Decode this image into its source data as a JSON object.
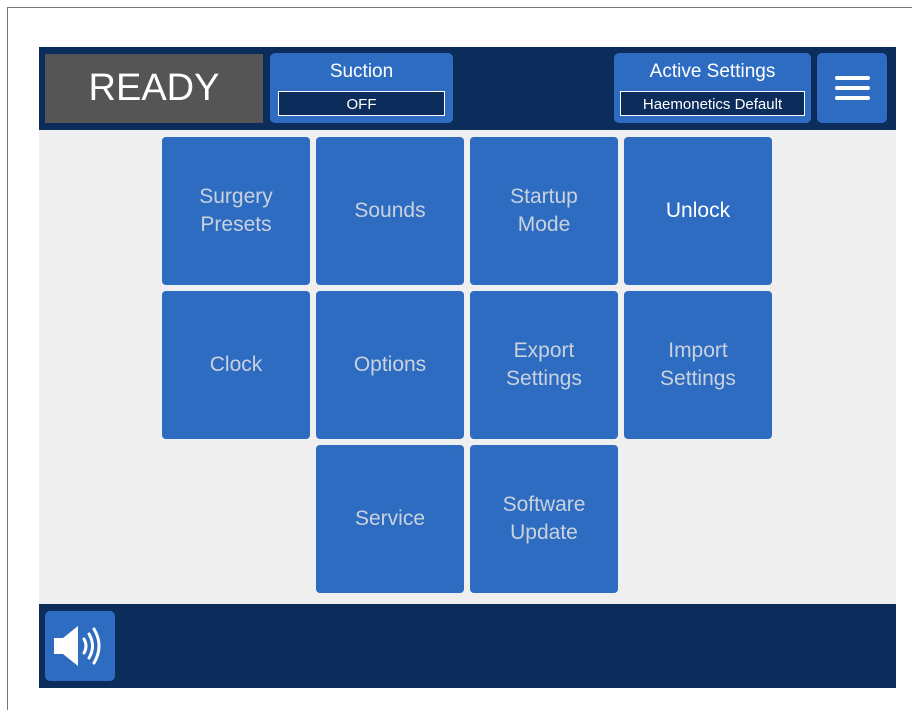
{
  "status": {
    "label": "READY"
  },
  "suction": {
    "title": "Suction",
    "value": "OFF"
  },
  "active_settings": {
    "title": "Active Settings",
    "value": "Haemonetics Default"
  },
  "menu": {
    "icon": "hamburger-menu-icon"
  },
  "tiles": [
    {
      "label": "Surgery\nPresets"
    },
    {
      "label": "Sounds"
    },
    {
      "label": "Startup\nMode"
    },
    {
      "label": "Unlock"
    },
    {
      "label": "Clock"
    },
    {
      "label": "Options"
    },
    {
      "label": "Export\nSettings"
    },
    {
      "label": "Import\nSettings"
    },
    {
      "label": "Service"
    },
    {
      "label": "Software\nUpdate"
    }
  ],
  "sound": {
    "icon": "speaker-volume-icon"
  },
  "colors": {
    "header_bg": "#0c2d5b",
    "button_blue": "#2d6cc0",
    "status_bg": "#555555",
    "content_bg": "#efefef",
    "dim_text": "#c9d2de"
  }
}
